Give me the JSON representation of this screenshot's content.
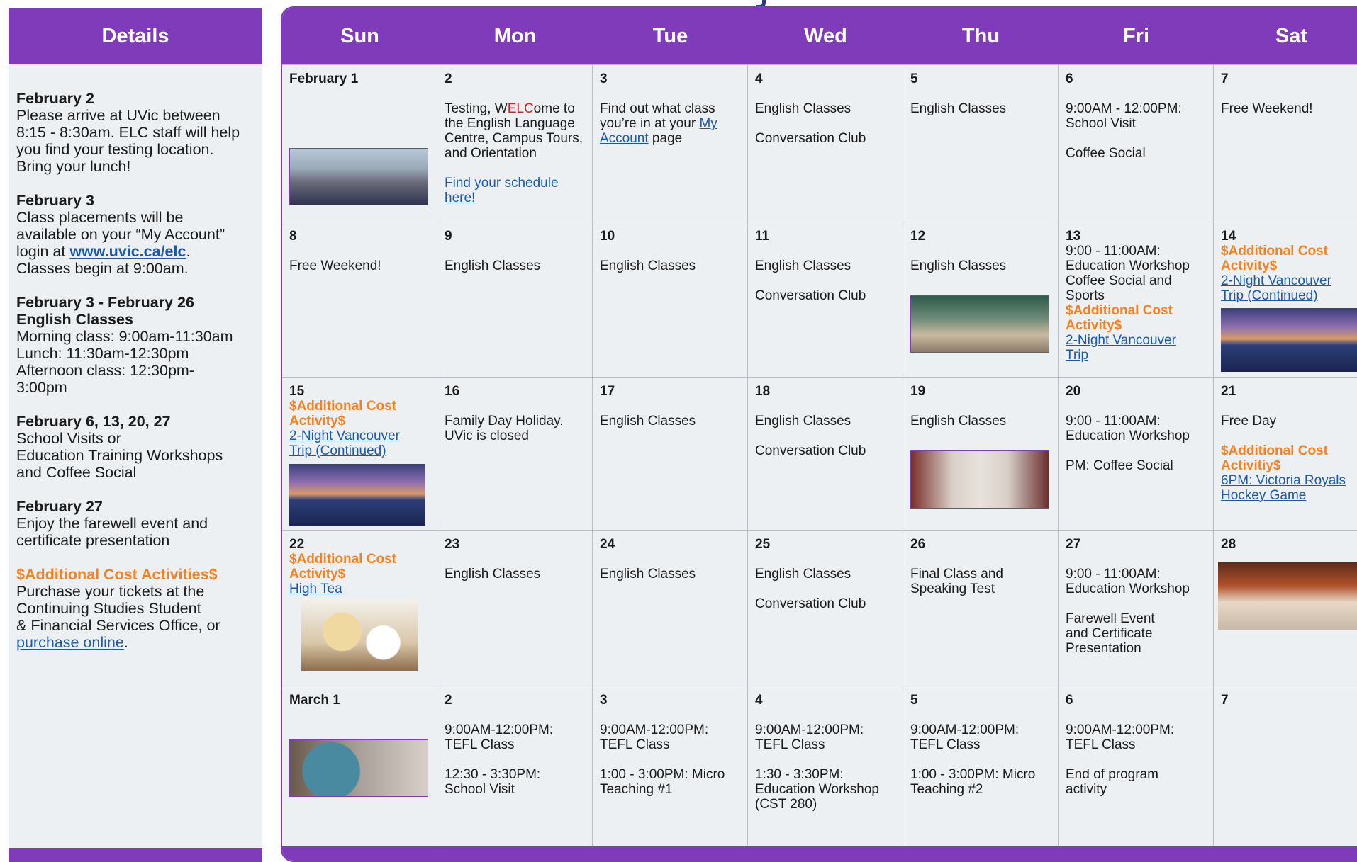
{
  "sidebar": {
    "title": "Details",
    "blocks": [
      {
        "title": "February 2",
        "lines": [
          "Please arrive at UVic between",
          "8:15 - 8:30am. ELC staff will help",
          "you find your testing location.",
          "Bring your lunch!"
        ]
      },
      {
        "title": "February 3",
        "lines": [
          "Class placements will be",
          "available on your “My Account”"
        ],
        "login_prefix": "login at ",
        "login_link": "www.uvic.ca/elc",
        "login_suffix": ".",
        "after": "Classes begin at 9:00am."
      },
      {
        "title": "February 3 - February 26",
        "title2": "English Classes",
        "lines": [
          "Morning class: 9:00am-11:30am",
          "Lunch: 11:30am-12:30pm",
          "Afternoon class: 12:30pm-",
          "3:00pm"
        ]
      },
      {
        "title": "February 6, 13, 20, 27",
        "lines": [
          "School Visits or",
          "Education Training Workshops",
          "and Coffee Social"
        ]
      },
      {
        "title": "February 27",
        "lines": [
          "Enjoy the farewell event and",
          "certificate presentation"
        ]
      },
      {
        "title": "$Additional Cost Activities$",
        "lines": [
          "Purchase your tickets at the",
          "Continuing Studies Student",
          "& Financial Services Office, or"
        ],
        "link": "purchase online",
        "link_suffix": "."
      }
    ]
  },
  "calendar": {
    "days": [
      "Sun",
      "Mon",
      "Tue",
      "Wed",
      "Thu",
      "Fri",
      "Sat"
    ],
    "w1": {
      "sun": {
        "date": "February 1"
      },
      "mon": {
        "date": "2",
        "t_a": "Testing, W",
        "t_b": "ELC",
        "t_c": "ome to",
        "lines": [
          "the English Language",
          "Centre, Campus Tours,",
          "and Orientation"
        ],
        "link1": "Find your schedule ",
        "link2": "here!"
      },
      "tue": {
        "date": "3",
        "l1": "Find out what class",
        "l2a": "you’re in at your ",
        "l2b": "My",
        "l3a": "Account",
        "l3b": " page"
      },
      "wed": {
        "date": "4",
        "e1": "English Classes",
        "e2": "Conversation Club"
      },
      "thu": {
        "date": "5",
        "e1": "English Classes"
      },
      "fri": {
        "date": "6",
        "e1": "9:00AM - 12:00PM:",
        "e2": "School Visit",
        "e3": "Coffee Social"
      },
      "sat": {
        "date": "7",
        "e1": "Free Weekend!"
      }
    },
    "w2": {
      "sun": {
        "date": "8",
        "e1": "Free Weekend!"
      },
      "mon": {
        "date": "9",
        "e1": "English Classes"
      },
      "tue": {
        "date": "10",
        "e1": "English Classes"
      },
      "wed": {
        "date": "11",
        "e1": "English Classes",
        "e2": "Conversation Club"
      },
      "thu": {
        "date": "12",
        "e1": "English Classes"
      },
      "fri": {
        "date": "13",
        "lines": [
          "9:00 - 11:00AM:",
          "Education Workshop",
          "Coffee Social and",
          "Sports"
        ],
        "cost1": "$Additional Cost",
        "cost2": "Activity$",
        "link1": "2-Night Vancouver ",
        "link2": "Trip"
      },
      "sat": {
        "date": "14",
        "cost1": "$Additional Cost",
        "cost2": "Activity$",
        "link1": "2-Night Vancouver ",
        "link2": "Trip (Continued)"
      }
    },
    "w3": {
      "sun": {
        "date": "15",
        "cost1": "$Additional Cost",
        "cost2": "Activity$",
        "link1": "2-Night Vancouver ",
        "link2": "Trip (Continued)"
      },
      "mon": {
        "date": "16",
        "e1": "Family Day Holiday.",
        "e2": "UVic is closed"
      },
      "tue": {
        "date": "17",
        "e1": "English Classes"
      },
      "wed": {
        "date": "18",
        "e1": "English Classes",
        "e2": "Conversation Club"
      },
      "thu": {
        "date": "19",
        "e1": "English Classes"
      },
      "fri": {
        "date": "20",
        "e1": "9:00 - 11:00AM:",
        "e2": "Education Workshop",
        "e3": "PM: Coffee Social"
      },
      "sat": {
        "date": "21",
        "e1": "Free Day",
        "cost1": "$Additional Cost",
        "cost2": "Activitiy$",
        "link1": "6PM: Victoria Royals",
        "link2": "Hockey Game"
      }
    },
    "w4": {
      "sun": {
        "date": "22",
        "cost1": "$Additional Cost",
        "cost2": "Activity$",
        "link1": "High Tea"
      },
      "mon": {
        "date": "23",
        "e1": "English Classes"
      },
      "tue": {
        "date": "24",
        "e1": "English Classes"
      },
      "wed": {
        "date": "25",
        "e1": "English Classes",
        "e2": "Conversation Club"
      },
      "thu": {
        "date": "26",
        "e1": "Final Class and",
        "e2": "Speaking Test"
      },
      "fri": {
        "date": "27",
        "e1": "9:00 - 11:00AM:",
        "e2": "Education Workshop",
        "e3": "Farewell Event",
        "e4": "and Certificate",
        "e5": "Presentation"
      },
      "sat": {
        "date": "28"
      }
    },
    "w5": {
      "sun": {
        "date": "March 1"
      },
      "mon": {
        "date": "2",
        "e1": "9:00AM-12:00PM:",
        "e2": "TEFL Class",
        "e3": "12:30 - 3:30PM:",
        "e4": "School Visit"
      },
      "tue": {
        "date": "3",
        "e1": "9:00AM-12:00PM:",
        "e2": "TEFL Class",
        "e3": "1:00 - 3:00PM: Micro",
        "e4": "Teaching #1"
      },
      "wed": {
        "date": "4",
        "e1": "9:00AM-12:00PM:",
        "e2": "TEFL Class",
        "e3": "1:30 - 3:30PM:",
        "e4": "Education Workshop",
        "e5": "(CST 280)"
      },
      "thu": {
        "date": "5",
        "e1": "9:00AM-12:00PM:",
        "e2": "TEFL Class",
        "e3": "1:00 - 3:00PM: Micro",
        "e4": "Teaching #2"
      },
      "fri": {
        "date": "6",
        "e1": "9:00AM-12:00PM:",
        "e2": "TEFL Class",
        "e3": "End of program",
        "e4": "activity"
      },
      "sat": {
        "date": "7"
      }
    }
  },
  "colors": {
    "header": "#7f3bb9",
    "cost": "#f5821f",
    "link": "#1a5aa8",
    "elc": "#d51f26",
    "background": "#edf0f3"
  }
}
